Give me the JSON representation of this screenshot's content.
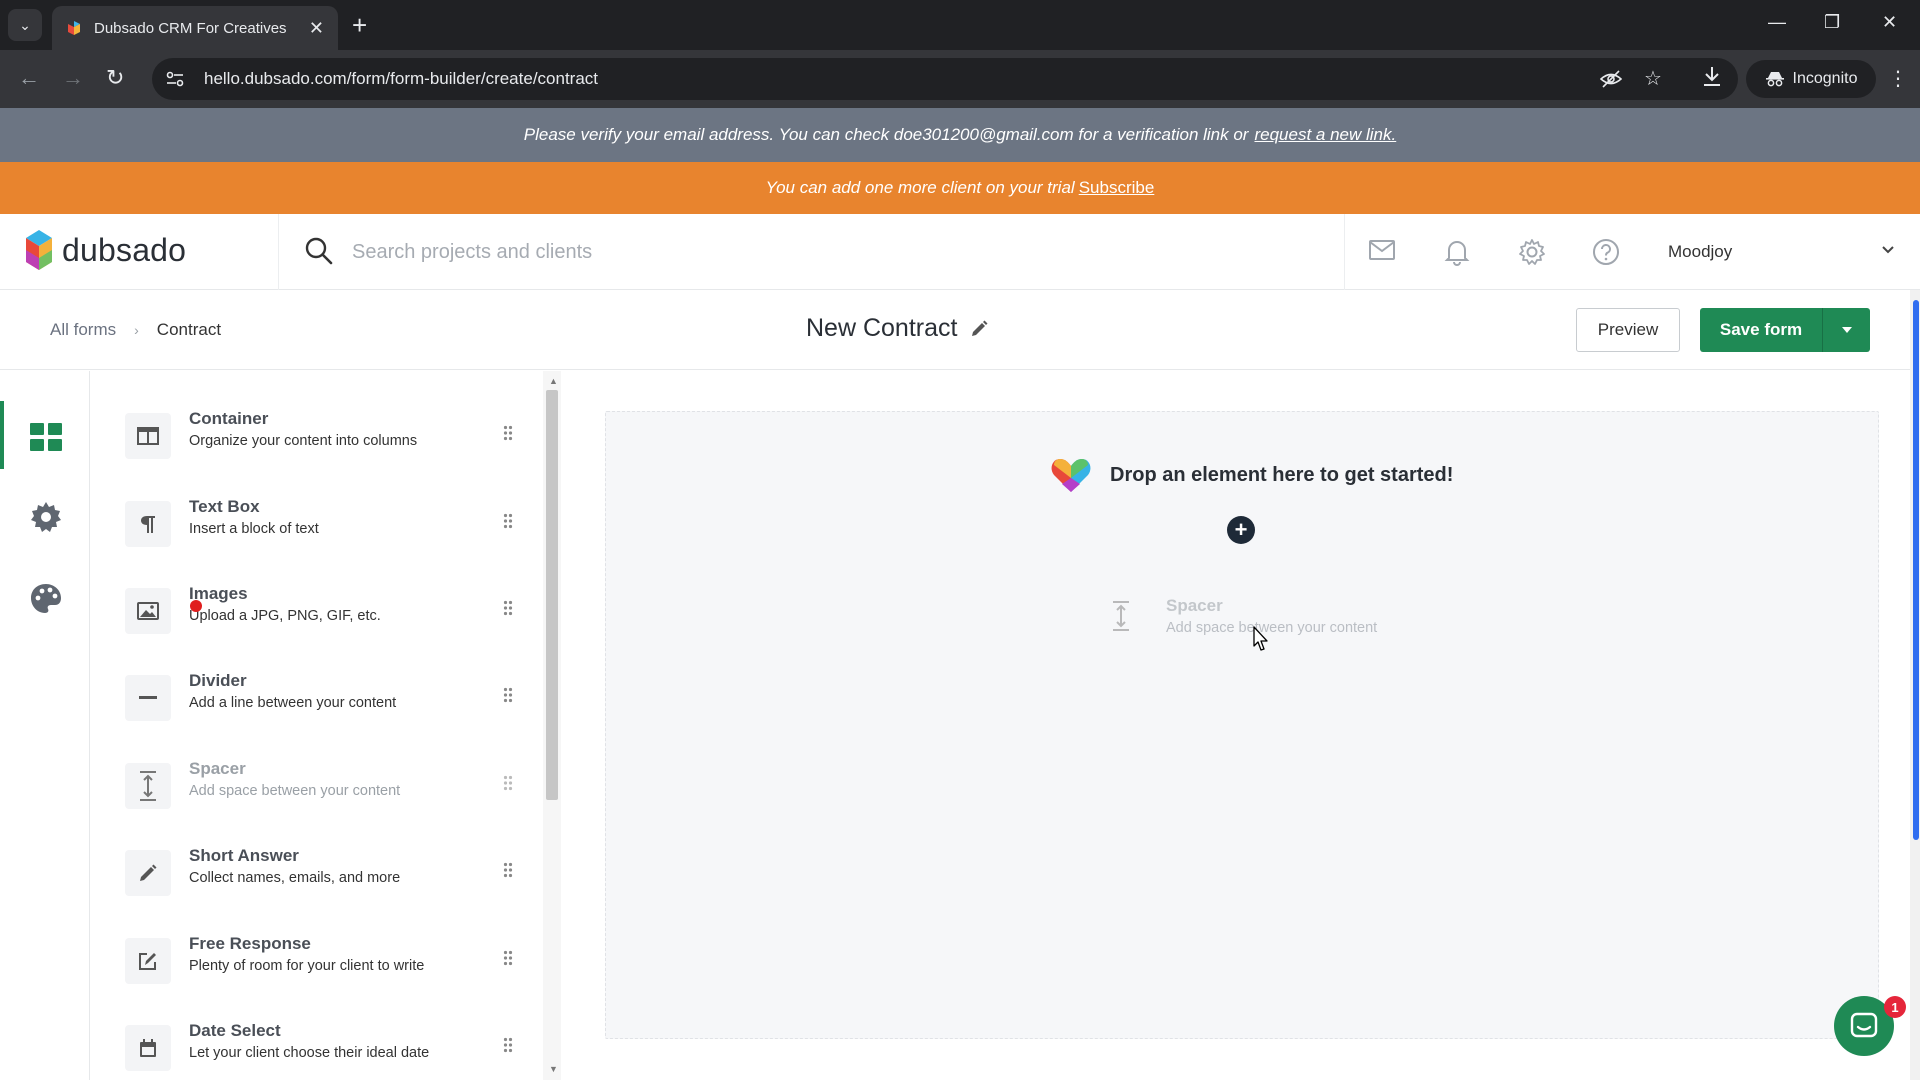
{
  "browser": {
    "tab_title": "Dubsado CRM For Creatives",
    "url": "hello.dubsado.com/form/form-builder/create/contract",
    "incognito_label": "Incognito"
  },
  "banners": {
    "verify_text": "Please verify your email address. You can check doe301200@gmail.com for a verification link or",
    "verify_link": "request a new link.",
    "trial_text": "You can add one more client on your trial",
    "trial_link": "Subscribe"
  },
  "header": {
    "logo_text": "dubsado",
    "search_placeholder": "Search projects and clients",
    "user_name": "Moodjoy"
  },
  "builder": {
    "breadcrumb_root": "All forms",
    "breadcrumb_current": "Contract",
    "form_title": "New Contract",
    "preview_label": "Preview",
    "save_label": "Save form"
  },
  "palette": {
    "items": [
      {
        "title": "Container",
        "desc": "Organize your content into columns",
        "icon": "container-icon"
      },
      {
        "title": "Text Box",
        "desc": "Insert a block of text",
        "icon": "paragraph-icon"
      },
      {
        "title": "Images",
        "desc": "Upload a JPG, PNG, GIF, etc.",
        "icon": "image-icon"
      },
      {
        "title": "Divider",
        "desc": "Add a line between your content",
        "icon": "divider-icon"
      },
      {
        "title": "Spacer",
        "desc": "Add space between your content",
        "icon": "spacer-icon"
      },
      {
        "title": "Short Answer",
        "desc": "Collect names, emails, and more",
        "icon": "pencil-icon"
      },
      {
        "title": "Free Response",
        "desc": "Plenty of room for your client to write",
        "icon": "edit-icon"
      },
      {
        "title": "Date Select",
        "desc": "Let your client choose their ideal date",
        "icon": "calendar-icon"
      }
    ]
  },
  "canvas": {
    "drop_text": "Drop an element here to get started!",
    "ghost_title": "Spacer",
    "ghost_desc": "Add space between your content"
  },
  "chat": {
    "badge_count": "1"
  },
  "colors": {
    "accent_green": "#1f8a55",
    "trial_orange": "#e8842e",
    "verify_gray": "#6c7583"
  }
}
